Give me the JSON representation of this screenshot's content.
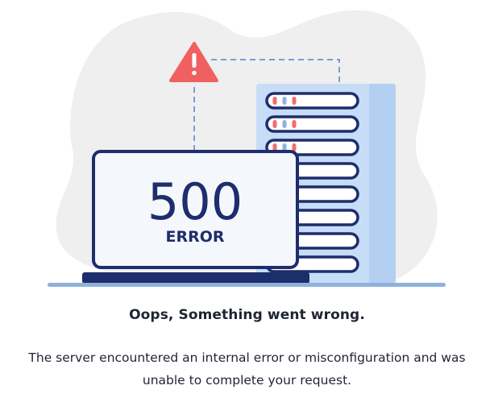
{
  "error": {
    "code": "500",
    "label": "ERROR",
    "heading": "Oops, Something went wrong.",
    "message": "The server encountered an internal error or misconfiguration and was unable to complete your request."
  },
  "icons": {
    "warning": "warning-icon",
    "server": "server-rack-icon",
    "laptop": "laptop-icon"
  },
  "colors": {
    "navy": "#1e2d6b",
    "screen": "#f4f7fc",
    "server_light": "#c7dcf6",
    "server_mid": "#b3cff1",
    "alert_red": "#f06060",
    "led_red": "#f26d6d",
    "led_blue": "#8fb1e6",
    "blob": "#efeff0",
    "floor": "#8fb1dc",
    "dash": "#7e9bd3"
  }
}
